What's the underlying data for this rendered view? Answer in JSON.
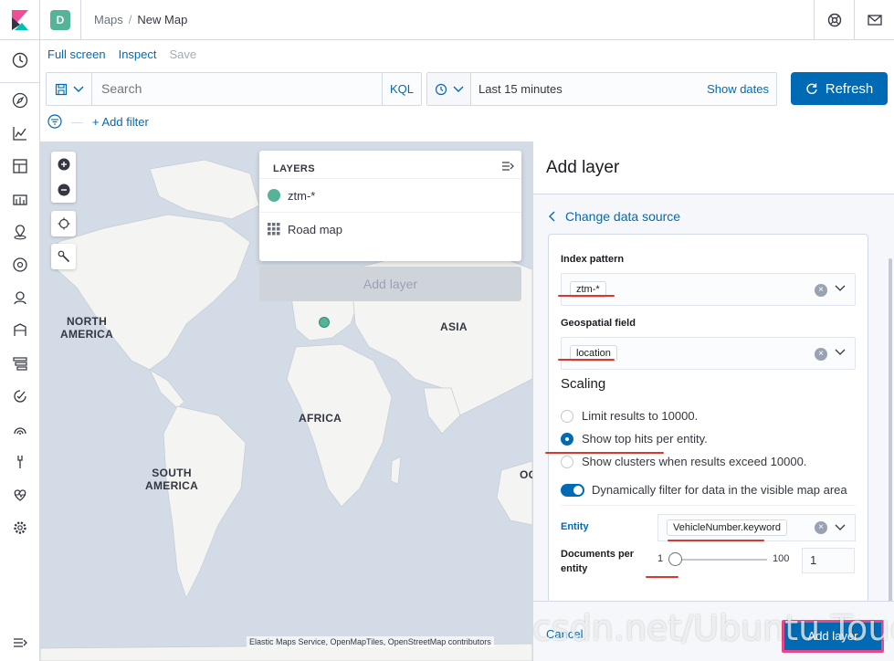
{
  "header": {
    "space_initial": "D",
    "breadcrumbs": [
      "Maps",
      "New Map"
    ],
    "icons": [
      "help-icon",
      "mail-icon"
    ]
  },
  "leftnav": {
    "icons": [
      "clock-icon",
      "compass-icon",
      "visualize-icon",
      "dashboard-icon",
      "canvas-icon",
      "maps-icon",
      "ml-icon",
      "siem-icon",
      "apm-icon",
      "uptime-icon",
      "infra-icon",
      "logs-icon",
      "dev-tools-icon",
      "monitoring-icon",
      "settings-icon",
      "collapse-icon"
    ]
  },
  "top_links": {
    "full_screen": "Full screen",
    "inspect": "Inspect",
    "save": "Save"
  },
  "query": {
    "placeholder": "Search",
    "language": "KQL"
  },
  "date": {
    "range": "Last 15 minutes",
    "show_dates": "Show dates"
  },
  "refresh_label": "Refresh",
  "filter": {
    "add_label": "+ Add filter"
  },
  "map": {
    "labels": {
      "north_america": "NORTH\nAMERICA",
      "south_america": "SOUTH\nAMERICA",
      "africa": "AFRICA",
      "asia": "ASIA",
      "oceania_partial": "OC"
    },
    "attribution": "Elastic Maps Service, OpenMapTiles, OpenStreetMap contributors",
    "layers_title": "LAYERS",
    "layers": [
      {
        "name": "ztm-*",
        "icon": "circle-icon"
      },
      {
        "name": "Road map",
        "icon": "grid-icon"
      }
    ],
    "add_layer_disabled": "Add layer"
  },
  "flyout": {
    "title": "Add layer",
    "change_source": "Change data source",
    "index_pattern": {
      "label": "Index pattern",
      "value": "ztm-*"
    },
    "geo_field": {
      "label": "Geospatial field",
      "value": "location"
    },
    "scaling": {
      "title": "Scaling",
      "options": [
        {
          "label": "Limit results to 10000.",
          "selected": false
        },
        {
          "label": "Show top hits per entity.",
          "selected": true
        },
        {
          "label": "Show clusters when results exceed 10000.",
          "selected": false
        }
      ]
    },
    "dynamic_filter": {
      "label": "Dynamically filter for data in the visible map area",
      "on": true
    },
    "entity": {
      "label": "Entity",
      "value": "VehicleNumber.keyword"
    },
    "docs_per_entity": {
      "label": "Documents per entity",
      "min": "1",
      "max": "100",
      "value": "1",
      "fraction": 0.0
    },
    "cancel": "Cancel",
    "add_layer": "Add layer"
  },
  "watermark": "csdn.net/Ubuntu Touch",
  "colors": {
    "primary": "#006bb4",
    "entity": "#54b399",
    "annotation": "#d9382f",
    "highlight": "#e8488b"
  }
}
